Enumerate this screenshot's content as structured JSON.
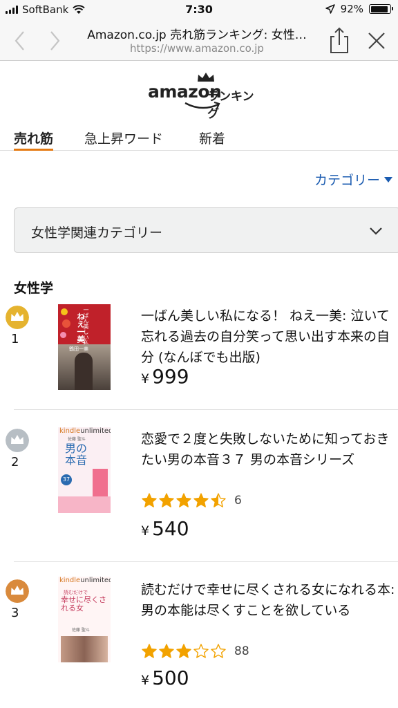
{
  "status_bar": {
    "carrier": "SoftBank",
    "time": "7:30",
    "battery": "92%",
    "battery_level": 0.92
  },
  "browser": {
    "title": "Amazon.co.jp 売れ筋ランキング: 女性…",
    "url": "https://www.amazon.co.jp"
  },
  "logo": {
    "brand": "amazon",
    "suffix": "ランキング"
  },
  "tabs": [
    {
      "label": "売れ筋",
      "active": true
    },
    {
      "label": "急上昇ワード",
      "active": false
    },
    {
      "label": "新着",
      "active": false
    }
  ],
  "category_link": "カテゴリー",
  "dropdown": {
    "label": "女性学関連カテゴリー"
  },
  "section_title": "女性学",
  "items": [
    {
      "rank": "1",
      "badge_color": "#e5b32f",
      "title": "一ばん美しい私になる！ ねえ一美: 泣いて忘れる過去の自分笑って思い出す本来の自分 (なんぼでも出版)",
      "price": "999",
      "rating": null,
      "reviews": null,
      "cover": {
        "big_text": "ねえ一美",
        "small_text": "一ばん美しい私になる",
        "author": "鶴田一美"
      }
    },
    {
      "rank": "2",
      "badge_color": "#b7bec4",
      "title": "恋愛で２度と失敗しないために知っておきたい男の本音３７ 男の本音シリーズ",
      "price": "540",
      "rating": 4.5,
      "reviews": "6",
      "cover": {
        "brand_a": "kindle",
        "brand_b": "unlimited",
        "big_text": "男の本音",
        "number": "37",
        "author": "佐藤 聖斗"
      }
    },
    {
      "rank": "3",
      "badge_color": "#d98a3c",
      "title": "読むだけで幸せに尽くされる女になれる本: 男の本能は尽くすことを欲している",
      "price": "500",
      "rating": 3,
      "reviews": "88",
      "cover": {
        "brand_a": "kindle",
        "brand_b": "unlimited",
        "big_text": "幸せに尽くされる女",
        "small_text": "読むだけで",
        "author": "佐藤 聖斗"
      }
    }
  ],
  "colors": {
    "accent": "#e47911",
    "link": "#1a5bb0",
    "star": "#f2a200"
  }
}
